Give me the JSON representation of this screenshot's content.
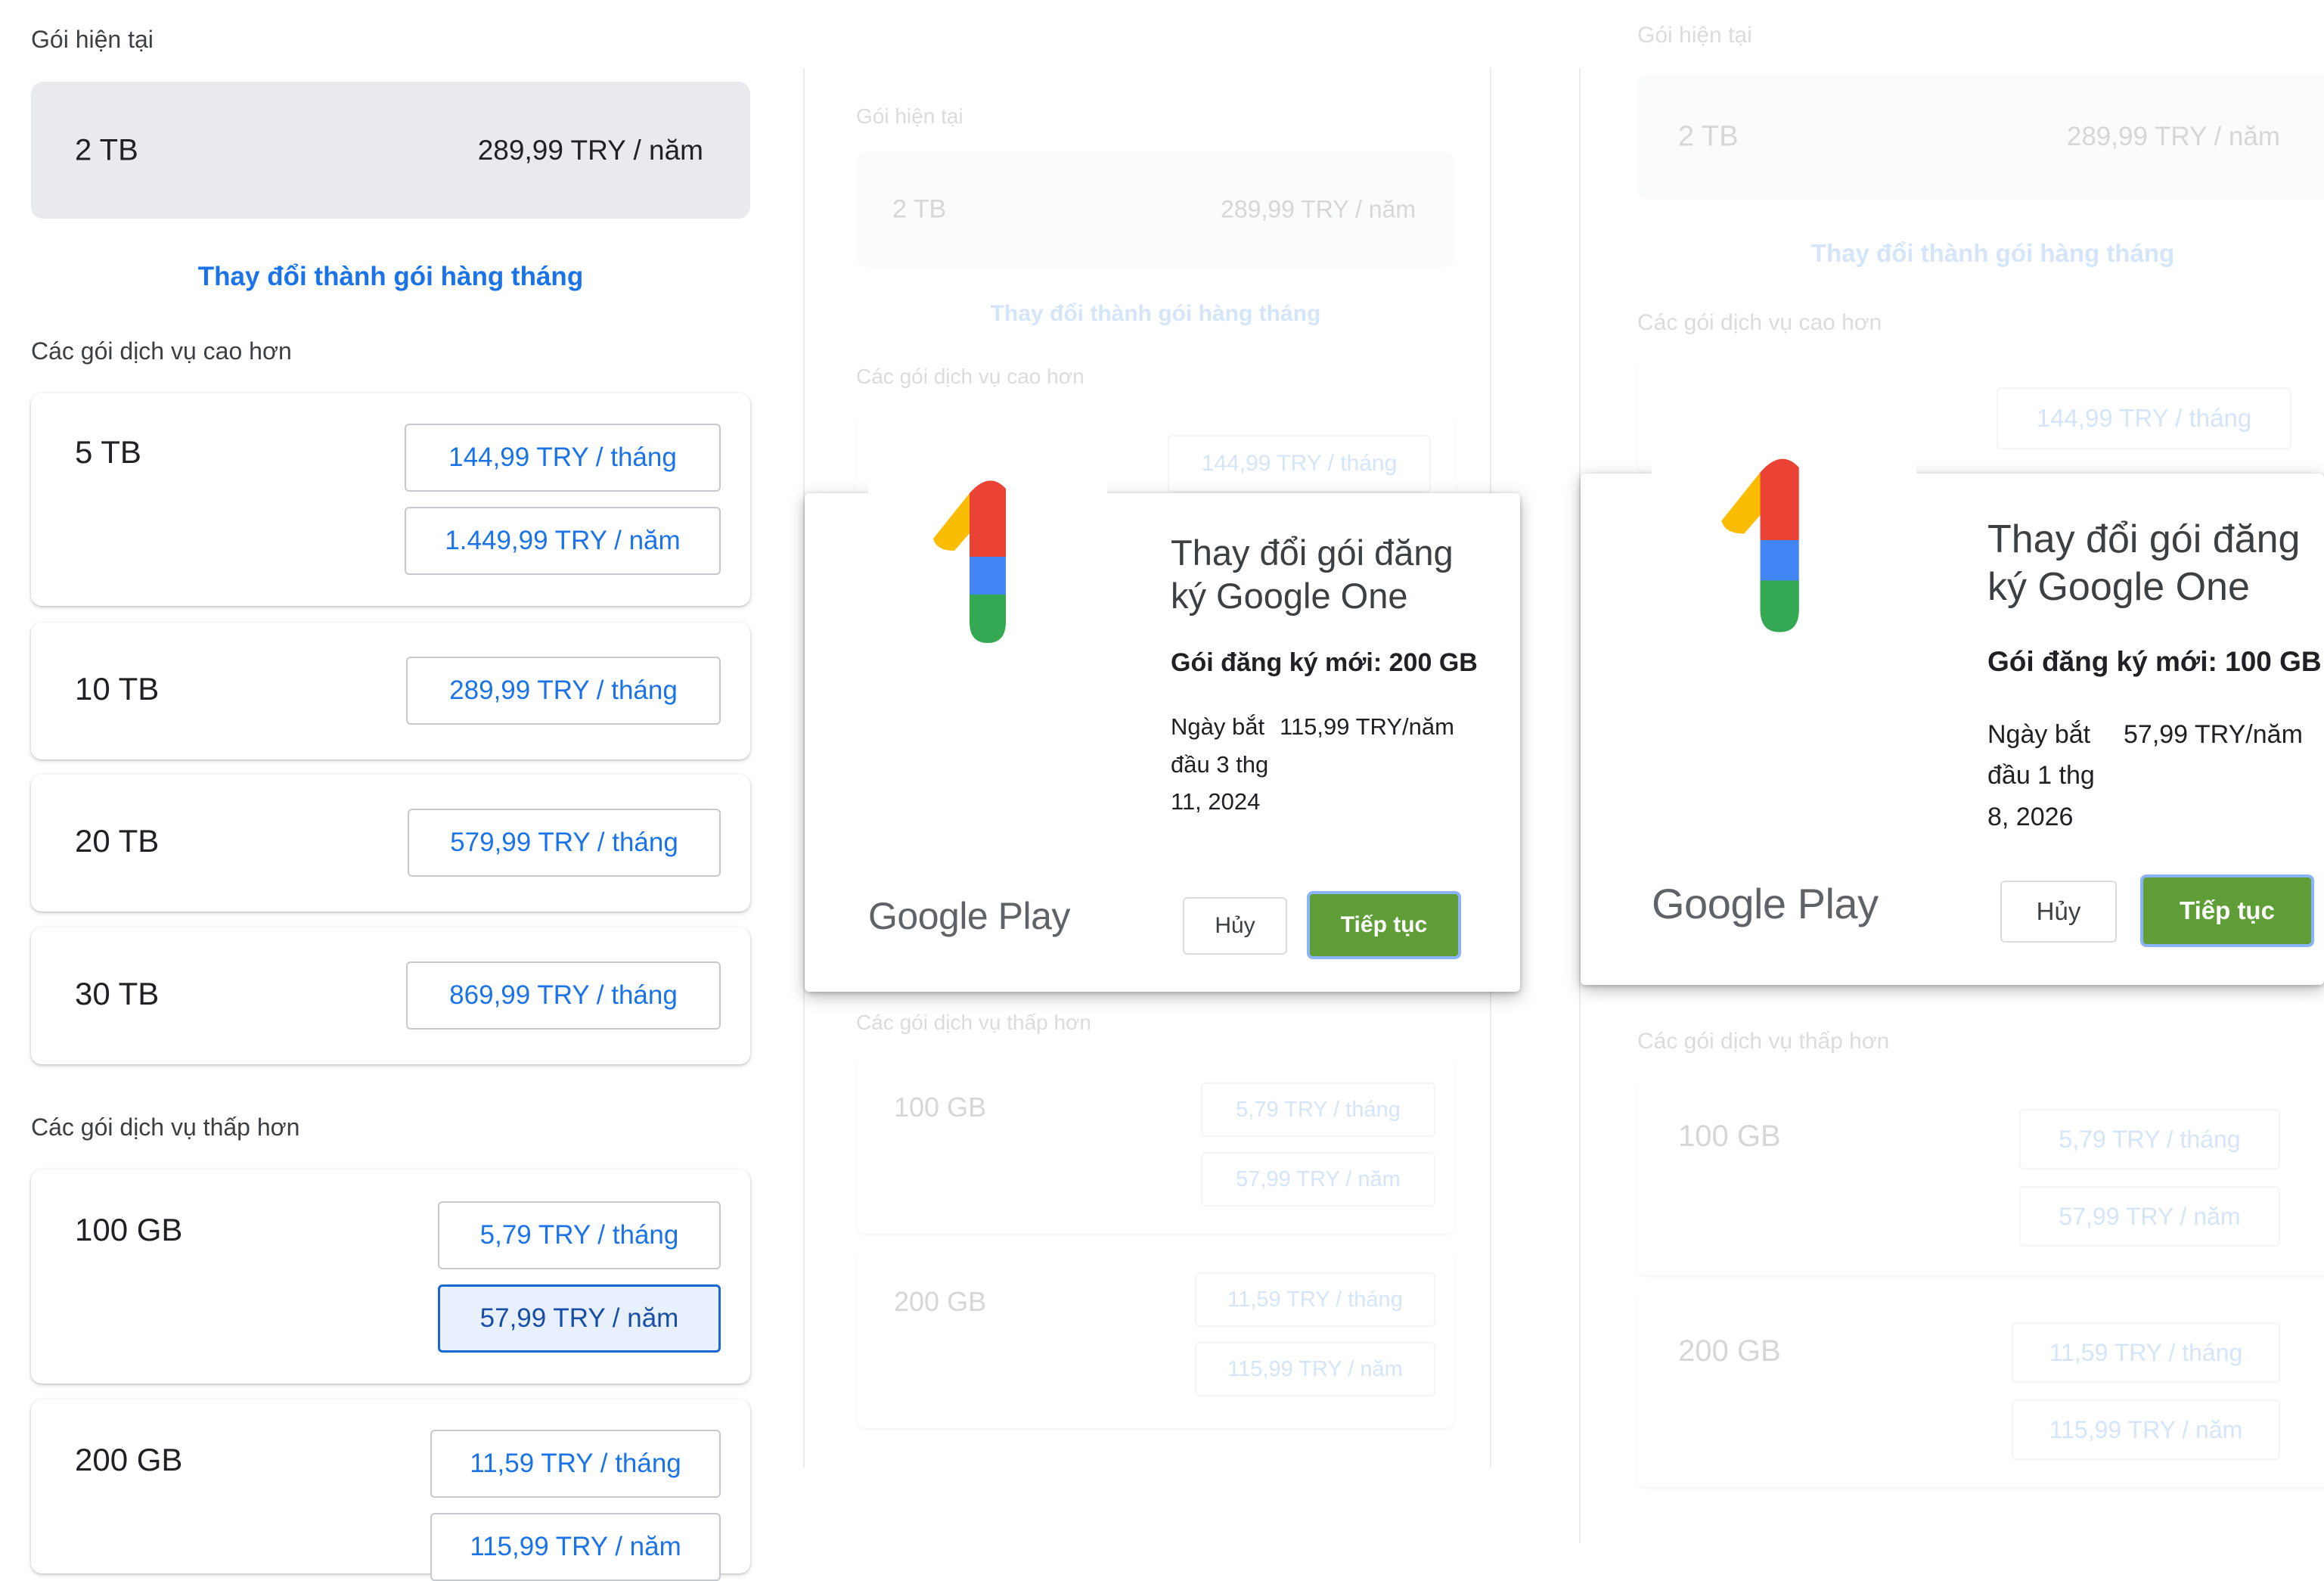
{
  "current": {
    "label": "Gói hiện tại",
    "size": "2 TB",
    "price": "289,99 TRY / năm",
    "change_link": "Thay đổi thành gói hàng tháng"
  },
  "higher": {
    "label": "Các gói dịch vụ cao hơn",
    "plans": [
      {
        "size": "5 TB",
        "monthly": "144,99 TRY / tháng",
        "yearly": "1.449,99 TRY / năm"
      },
      {
        "size": "10 TB",
        "monthly": "289,99 TRY / tháng"
      },
      {
        "size": "20 TB",
        "monthly": "579,99 TRY / tháng"
      },
      {
        "size": "30 TB",
        "monthly": "869,99 TRY / tháng"
      }
    ]
  },
  "lower": {
    "label": "Các gói dịch vụ thấp hơn",
    "plans": [
      {
        "size": "100 GB",
        "monthly": "5,79 TRY / tháng",
        "yearly": "57,99 TRY / năm",
        "selected": "yearly"
      },
      {
        "size": "200 GB",
        "monthly": "11,59 TRY / tháng",
        "yearly": "115,99 TRY / năm"
      }
    ]
  },
  "dialog1": {
    "title": "Thay đổi gói đăng ký Google One",
    "subtitle": "Gói đăng ký mới: 200 GB",
    "start_date": "Ngày bắt đầu 3 thg 11, 2024",
    "price": "115,99 TRY/năm",
    "brand": "Google Play",
    "cancel": "Hủy",
    "continue": "Tiếp tục"
  },
  "dialog2": {
    "title": "Thay đổi gói đăng ký Google One",
    "subtitle": "Gói đăng ký mới: 100 GB",
    "start_date": "Ngày bắt đầu 1 thg 8, 2026",
    "price": "57,99 TRY/năm",
    "brand": "Google Play",
    "cancel": "Hủy",
    "continue": "Tiếp tục"
  },
  "colors": {
    "link_blue": "#1a73e8",
    "continue_green": "#5f9e37",
    "current_bg": "#e8eaed",
    "logo_red": "#ea4335",
    "logo_yellow": "#fbbc04",
    "logo_blue": "#4285f4",
    "logo_green": "#34a853"
  }
}
